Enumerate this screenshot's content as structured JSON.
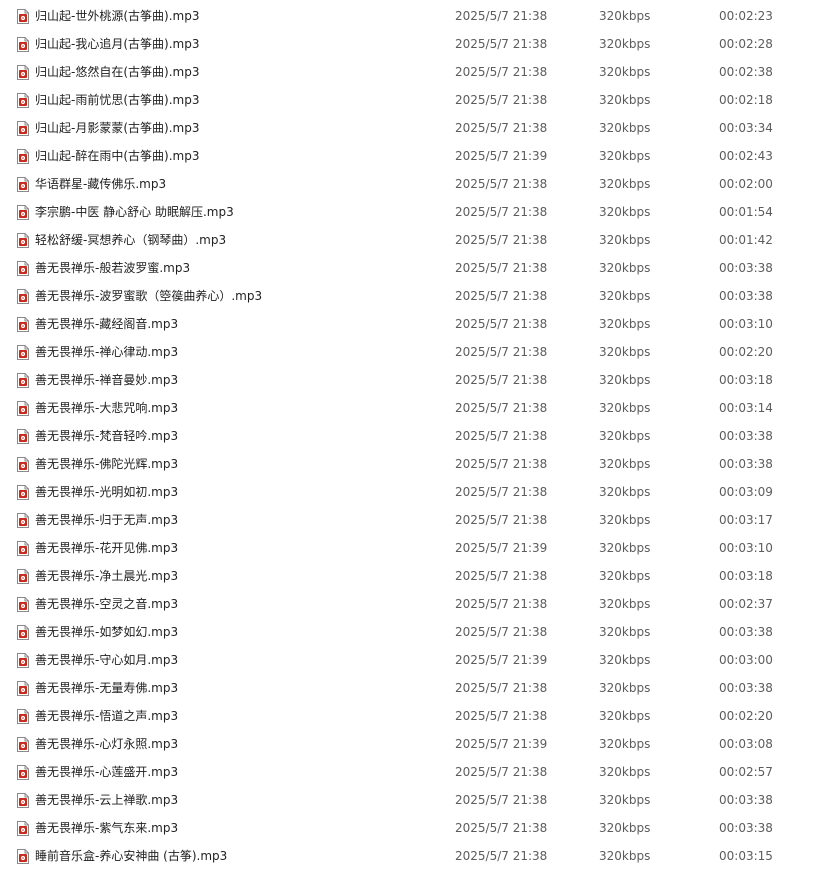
{
  "icons": {
    "file": "mp3-file-icon",
    "accent": "#c42b1c"
  },
  "files": [
    {
      "name": "归山起-世外桃源(古筝曲).mp3",
      "date": "2025/5/7 21:38",
      "bitrate": "320kbps",
      "duration": "00:02:23"
    },
    {
      "name": "归山起-我心追月(古筝曲).mp3",
      "date": "2025/5/7 21:38",
      "bitrate": "320kbps",
      "duration": "00:02:28"
    },
    {
      "name": "归山起-悠然自在(古筝曲).mp3",
      "date": "2025/5/7 21:38",
      "bitrate": "320kbps",
      "duration": "00:02:38"
    },
    {
      "name": "归山起-雨前忧思(古筝曲).mp3",
      "date": "2025/5/7 21:38",
      "bitrate": "320kbps",
      "duration": "00:02:18"
    },
    {
      "name": "归山起-月影蒙蒙(古筝曲).mp3",
      "date": "2025/5/7 21:38",
      "bitrate": "320kbps",
      "duration": "00:03:34"
    },
    {
      "name": "归山起-醉在雨中(古筝曲).mp3",
      "date": "2025/5/7 21:39",
      "bitrate": "320kbps",
      "duration": "00:02:43"
    },
    {
      "name": "华语群星-藏传佛乐.mp3",
      "date": "2025/5/7 21:38",
      "bitrate": "320kbps",
      "duration": "00:02:00"
    },
    {
      "name": "李宗鹏-中医 静心舒心 助眠解压.mp3",
      "date": "2025/5/7 21:38",
      "bitrate": "320kbps",
      "duration": "00:01:54"
    },
    {
      "name": "轻松舒缓-冥想养心（钢琴曲）.mp3",
      "date": "2025/5/7 21:38",
      "bitrate": "320kbps",
      "duration": "00:01:42"
    },
    {
      "name": "善无畏禅乐-般若波罗蜜.mp3",
      "date": "2025/5/7 21:38",
      "bitrate": "320kbps",
      "duration": "00:03:38"
    },
    {
      "name": "善无畏禅乐-波罗蜜歌（箜篌曲养心）.mp3",
      "date": "2025/5/7 21:38",
      "bitrate": "320kbps",
      "duration": "00:03:38"
    },
    {
      "name": "善无畏禅乐-藏经阁音.mp3",
      "date": "2025/5/7 21:38",
      "bitrate": "320kbps",
      "duration": "00:03:10"
    },
    {
      "name": "善无畏禅乐-禅心律动.mp3",
      "date": "2025/5/7 21:38",
      "bitrate": "320kbps",
      "duration": "00:02:20"
    },
    {
      "name": "善无畏禅乐-禅音曼妙.mp3",
      "date": "2025/5/7 21:38",
      "bitrate": "320kbps",
      "duration": "00:03:18"
    },
    {
      "name": "善无畏禅乐-大悲咒响.mp3",
      "date": "2025/5/7 21:38",
      "bitrate": "320kbps",
      "duration": "00:03:14"
    },
    {
      "name": "善无畏禅乐-梵音轻吟.mp3",
      "date": "2025/5/7 21:38",
      "bitrate": "320kbps",
      "duration": "00:03:38"
    },
    {
      "name": "善无畏禅乐-佛陀光辉.mp3",
      "date": "2025/5/7 21:38",
      "bitrate": "320kbps",
      "duration": "00:03:38"
    },
    {
      "name": "善无畏禅乐-光明如初.mp3",
      "date": "2025/5/7 21:38",
      "bitrate": "320kbps",
      "duration": "00:03:09"
    },
    {
      "name": "善无畏禅乐-归于无声.mp3",
      "date": "2025/5/7 21:38",
      "bitrate": "320kbps",
      "duration": "00:03:17"
    },
    {
      "name": "善无畏禅乐-花开见佛.mp3",
      "date": "2025/5/7 21:39",
      "bitrate": "320kbps",
      "duration": "00:03:10"
    },
    {
      "name": "善无畏禅乐-净土晨光.mp3",
      "date": "2025/5/7 21:38",
      "bitrate": "320kbps",
      "duration": "00:03:18"
    },
    {
      "name": "善无畏禅乐-空灵之音.mp3",
      "date": "2025/5/7 21:38",
      "bitrate": "320kbps",
      "duration": "00:02:37"
    },
    {
      "name": "善无畏禅乐-如梦如幻.mp3",
      "date": "2025/5/7 21:38",
      "bitrate": "320kbps",
      "duration": "00:03:38"
    },
    {
      "name": "善无畏禅乐-守心如月.mp3",
      "date": "2025/5/7 21:39",
      "bitrate": "320kbps",
      "duration": "00:03:00"
    },
    {
      "name": "善无畏禅乐-无量寿佛.mp3",
      "date": "2025/5/7 21:38",
      "bitrate": "320kbps",
      "duration": "00:03:38"
    },
    {
      "name": "善无畏禅乐-悟道之声.mp3",
      "date": "2025/5/7 21:38",
      "bitrate": "320kbps",
      "duration": "00:02:20"
    },
    {
      "name": "善无畏禅乐-心灯永照.mp3",
      "date": "2025/5/7 21:39",
      "bitrate": "320kbps",
      "duration": "00:03:08"
    },
    {
      "name": "善无畏禅乐-心莲盛开.mp3",
      "date": "2025/5/7 21:38",
      "bitrate": "320kbps",
      "duration": "00:02:57"
    },
    {
      "name": "善无畏禅乐-云上禅歌.mp3",
      "date": "2025/5/7 21:38",
      "bitrate": "320kbps",
      "duration": "00:03:38"
    },
    {
      "name": "善无畏禅乐-紫气东来.mp3",
      "date": "2025/5/7 21:38",
      "bitrate": "320kbps",
      "duration": "00:03:38"
    },
    {
      "name": "睡前音乐盒-养心安神曲 (古筝).mp3",
      "date": "2025/5/7 21:38",
      "bitrate": "320kbps",
      "duration": "00:03:15"
    }
  ]
}
